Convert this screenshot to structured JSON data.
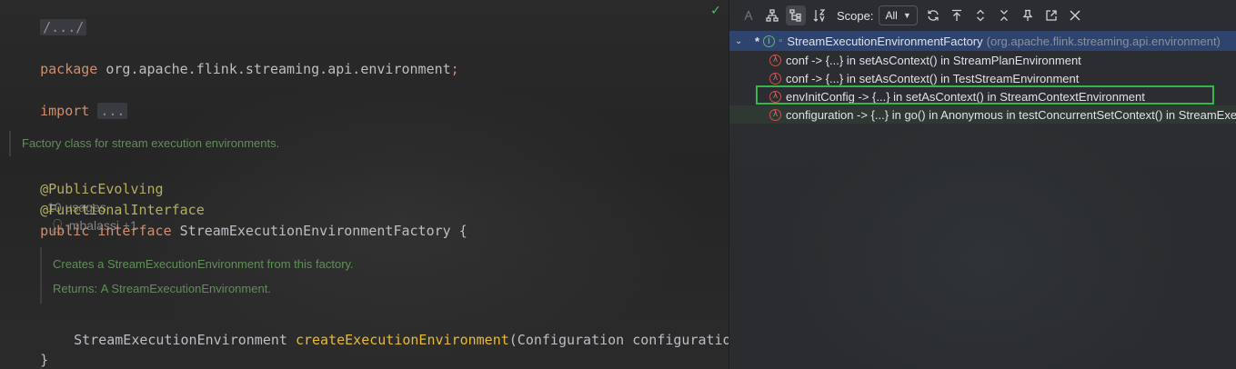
{
  "editor": {
    "folded_path": "/.../",
    "package_keyword": "package",
    "package_name": "org.apache.flink.streaming.api.environment",
    "semicolon": ";",
    "import_keyword": "import",
    "import_folded": "...",
    "class_doc": "Factory class for stream execution environments.",
    "annotation_1": "@PublicEvolving",
    "usages": "10 usages",
    "author": "mbalassi +1",
    "annotation_2": "@FunctionalInterface",
    "decl_public": "public",
    "decl_interface": "interface",
    "decl_name": "StreamExecutionEnvironmentFactory",
    "decl_brace": "{",
    "method_doc": "Creates a StreamExecutionEnvironment from this factory.",
    "returns_label": "Returns:",
    "returns_text": "A StreamExecutionEnvironment.",
    "method_return_type": "StreamExecutionEnvironment",
    "method_name": "createExecutionEnvironment",
    "method_params": "(Configuration configuration);",
    "closing_brace": "}"
  },
  "panel": {
    "scope_label": "Scope:",
    "scope_value": "All",
    "root": {
      "marker": "*",
      "name": "StreamExecutionEnvironmentFactory",
      "package": "(org.apache.flink.streaming.api.environment)"
    },
    "items": [
      {
        "text": "conf -> {...} in setAsContext() in StreamPlanEnvironment"
      },
      {
        "text": "conf -> {...} in setAsContext() in TestStreamEnvironment"
      },
      {
        "text": "envInitConfig -> {...} in setAsContext() in StreamContextEnvironment"
      },
      {
        "text": "configuration -> {...} in go() in Anonymous in testConcurrentSetContext() in StreamExecutionEnvironmentTest"
      }
    ]
  },
  "colors": {
    "highlight_box": "#35b64a",
    "root_selection": "#2e436e",
    "keyword": "#cf8e6d",
    "annotation": "#b3ae60",
    "doc_text": "#5f8f57"
  }
}
